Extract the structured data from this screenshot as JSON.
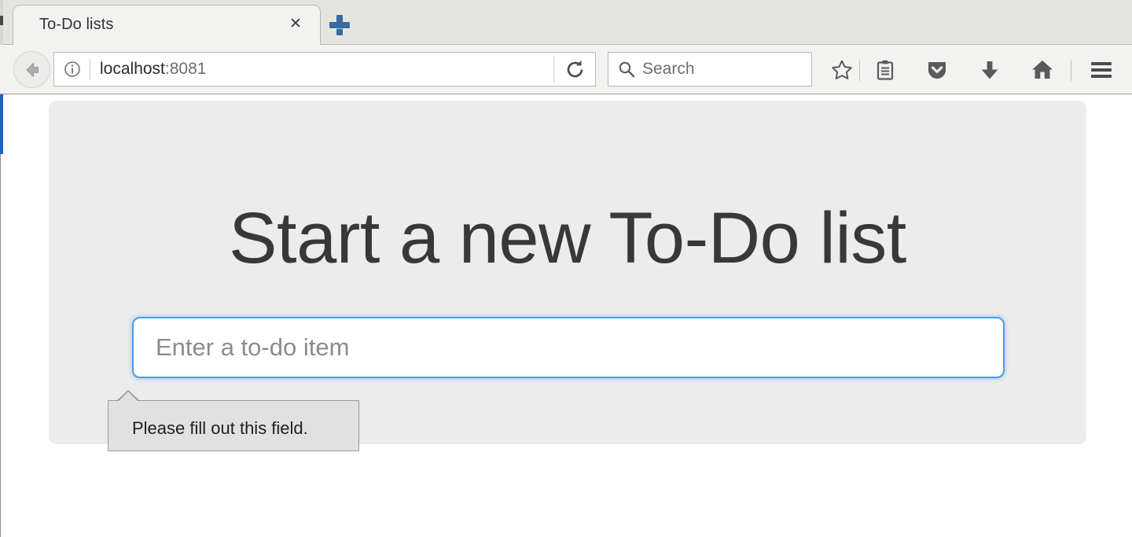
{
  "browser": {
    "tabs": [
      {
        "title": "To-Do lists",
        "close_label": "✕",
        "active": true
      }
    ],
    "new_tab_label": "+",
    "toolbar": {
      "back_icon": "back-arrow-icon",
      "identity_icon": "info-icon",
      "url_host": "localhost",
      "url_port": ":8081",
      "reload_icon": "reload-icon",
      "search_placeholder": "Search",
      "search_value": "",
      "search_icon": "search-icon",
      "bookmark_icon": "star-icon",
      "reader_list_icon": "clipboard-icon",
      "pocket_icon": "pocket-shield-icon",
      "downloads_icon": "download-arrow-icon",
      "home_icon": "home-icon",
      "menu_icon": "hamburger-menu-icon"
    }
  },
  "page": {
    "heading": "Start a new To-Do list",
    "input": {
      "placeholder": "Enter a to-do item",
      "value": ""
    },
    "validation_tooltip": {
      "message": "Please fill out this field."
    }
  },
  "colors": {
    "tabbar_bg": "#e4e4e1",
    "toolbar_bg": "#f2f2f0",
    "panel_bg": "#ececec",
    "heading_text": "#383838",
    "input_focus_border": "#4a9cf0",
    "tooltip_bg": "#e1e1e1",
    "tooltip_border": "#9a9a9a",
    "new_tab_plus": "#39699e",
    "behind_window_accent": "#1e63c8"
  }
}
